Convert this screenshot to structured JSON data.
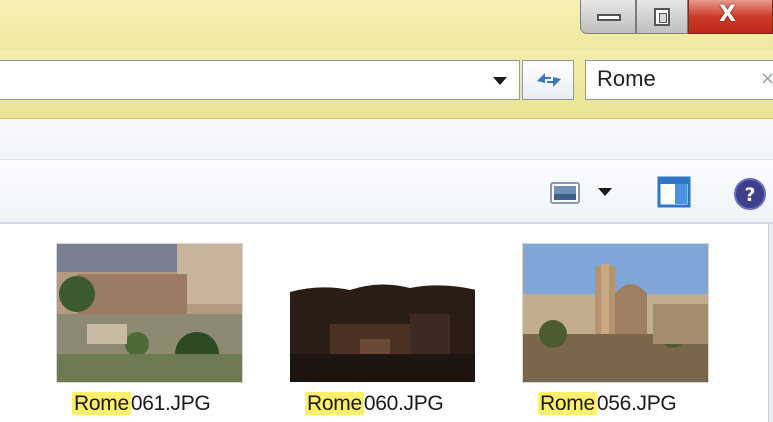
{
  "window": {
    "minimize_icon": "minimize-icon",
    "maximize_icon": "restore-icon",
    "close_label": "X"
  },
  "address_bar": {
    "value": "",
    "dropdown_icon": "chevron-down-icon",
    "refresh_icon": "refresh-arrows-icon"
  },
  "search": {
    "value": "Rome",
    "clear_label": "×"
  },
  "toolbar": {
    "view_icon": "change-view-icon",
    "view_menu_icon": "chevron-down-icon",
    "preview_pane_icon": "preview-pane-icon",
    "help_icon": "help-icon"
  },
  "files": [
    {
      "highlight": "Rome",
      "rest": "061.JPG"
    },
    {
      "highlight": "Rome",
      "rest": "060.JPG"
    },
    {
      "highlight": "Rome",
      "rest": "056.JPG"
    }
  ],
  "colors": {
    "aero_glass": "#efe8a0",
    "search_highlight": "#ffef6b",
    "close_button": "#cc3b2a"
  }
}
